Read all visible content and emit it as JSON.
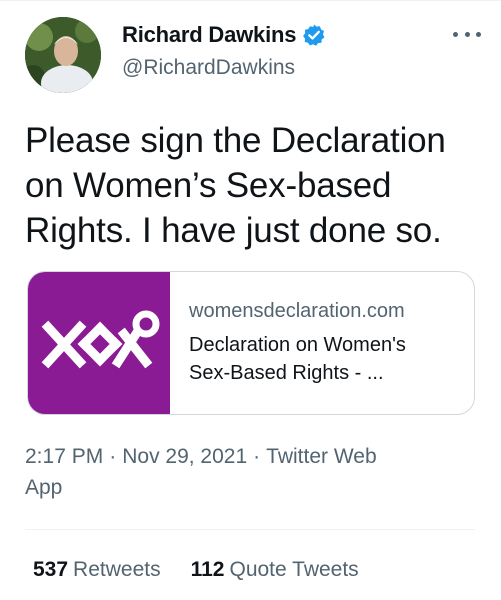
{
  "author": {
    "display_name": "Richard Dawkins",
    "handle": "@RichardDawkins",
    "verified_color": "#1d9bf0"
  },
  "icons": {
    "verified": "verified-badge-icon",
    "more": "more-options-icon",
    "card_logo": "womens-declaration-logo"
  },
  "tweet": {
    "line1": "Please sign the Declaration",
    "line2": "on Women’s Sex-based",
    "line3": "Rights. I have just done so."
  },
  "card": {
    "domain": "womensdeclaration.com",
    "title_line1": "Declaration on Women's",
    "title_line2": "Sex-Based Rights - ...",
    "image_color": "#8b1a95"
  },
  "meta": {
    "time": "2:17 PM",
    "separator": "·",
    "date": "Nov 29, 2021",
    "source_part1": "Twitter Web",
    "source_part2": "App"
  },
  "stats": {
    "retweets_count": "537",
    "retweets_label": "Retweets",
    "quotes_count": "112",
    "quotes_label": "Quote Tweets"
  }
}
